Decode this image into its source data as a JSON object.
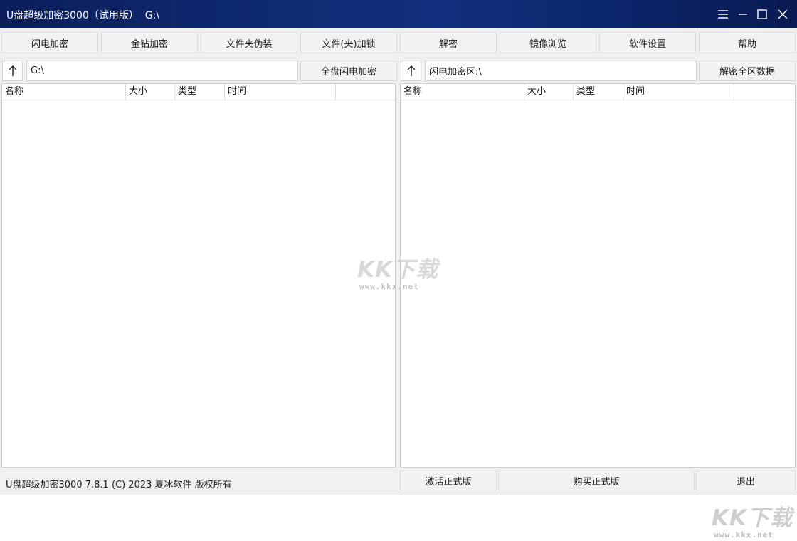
{
  "window": {
    "title": "U盘超级加密3000（试用版）  G:\\",
    "menu_icon": "menu-icon",
    "minimize_icon": "minimize-icon",
    "maximize_icon": "maximize-icon",
    "close_icon": "close-icon"
  },
  "toolbar": {
    "buttons": [
      "闪电加密",
      "金钻加密",
      "文件夹伪装",
      "文件(夹)加锁",
      "解密",
      "镜像浏览",
      "软件设置",
      "帮助"
    ]
  },
  "left_panel": {
    "up_icon": "arrow-up-icon",
    "path": "G:\\",
    "action_label": "全盘闪电加密",
    "columns": [
      "名称",
      "大小",
      "类型",
      "时间"
    ]
  },
  "right_panel": {
    "up_icon": "arrow-up-icon",
    "path": "闪电加密区:\\",
    "action_label": "解密全区数据",
    "columns": [
      "名称",
      "大小",
      "类型",
      "时间"
    ]
  },
  "status": {
    "text": "U盘超级加密3000 7.8.1 (C) 2023 夏冰软件 版权所有"
  },
  "bottom_buttons": {
    "activate": "激活正式版",
    "buy": "购买正式版",
    "exit": "退出"
  },
  "watermark": {
    "logo": "KK下载",
    "url": "www.kkx.net"
  },
  "colors": {
    "titlebar": "#13307e",
    "window_bg": "#f0f0f0",
    "button_bg": "#f2f2f2",
    "watermark": "#d0d0d0"
  }
}
